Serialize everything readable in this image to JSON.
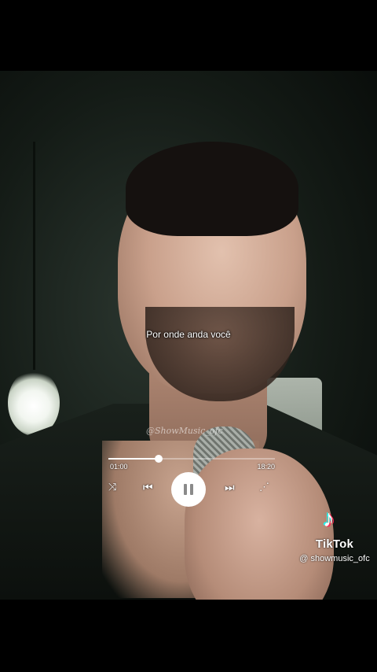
{
  "video": {
    "caption": "Por onde anda você",
    "watermark": "@ShowMusic_ofc"
  },
  "player": {
    "current_time": "01:00",
    "total_time": "18:20",
    "progress_fraction": 0.3,
    "controls": {
      "shuffle_icon": "⤨",
      "prev_icon": "⏮",
      "next_icon": "⏭",
      "repeat_icon": "⋰"
    }
  },
  "tiktok": {
    "brand": "TikTok",
    "handle": "@ showmusic_ofc",
    "logo_icon": "♪"
  },
  "colors": {
    "tiktok_cyan": "#25f4ee",
    "tiktok_red": "#fe2c55"
  }
}
